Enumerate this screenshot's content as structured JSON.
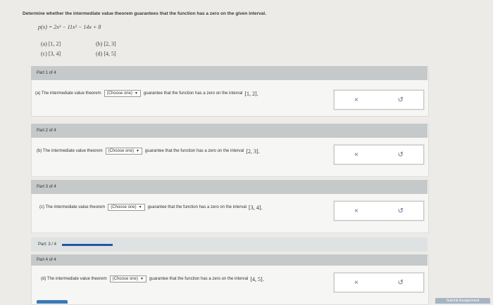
{
  "question": "Determine whether the intermediate value theorem guarantees that the function has a zero on the given interval.",
  "function": "p(x) = 2x³ − 11x² − 14x + 8",
  "choices": [
    "(a) [1, 2]",
    "(b) [2, 3]",
    "(c) [3, 4]",
    "(d) [4, 5]"
  ],
  "parts": [
    {
      "header": "Part 1 of 4",
      "prefix": "(a) The intermediate value theorem",
      "select": "(Choose one)",
      "suffix": "guarantee that the function has a zero on the interval",
      "interval": "[1, 2]."
    },
    {
      "header": "Part 2 of 4",
      "prefix": "(b) The intermediate value theorem",
      "select": "(Choose one)",
      "suffix": "guarantee that the function has a zero on the interval",
      "interval": "[2, 3]."
    },
    {
      "header": "Part 3 of 4",
      "prefix": "(c) The intermediate value theorem",
      "select": "(Choose one)",
      "suffix": "guarantee that the function has a zero on the interval",
      "interval": "[3, 4]."
    },
    {
      "header": "Part 4 of 4",
      "prefix": "(d) The intermediate value theorem",
      "select": "(Choose one)",
      "suffix": "guarantee that the function has a zero on the interval",
      "interval": "[4, 5]."
    }
  ],
  "answer_icons": {
    "clear": "×",
    "undo": "↺"
  },
  "progress": {
    "label": "Part: 3 / 4",
    "fraction": 0.75
  },
  "submit_label": "Submit Assignment"
}
